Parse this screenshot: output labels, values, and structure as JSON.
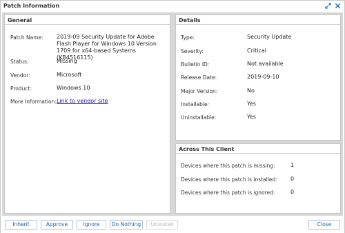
{
  "window": {
    "title": "Patch Information",
    "icons": [
      "expand-icon",
      "close-icon"
    ]
  },
  "general": {
    "header": "General",
    "rows": [
      {
        "label": "Patch Name:",
        "value": "2019-09 Security Update for Adobe Flash Player for Windows 10 Version 1709 for x64-based Systems (KB4516115)"
      },
      {
        "label": "Status:",
        "value": "Missing"
      },
      {
        "label": "Vendor:",
        "value": "Microsoft"
      },
      {
        "label": "Product:",
        "value": "Windows 10"
      },
      {
        "label": "More Information:",
        "value": "Link to vendor site"
      }
    ]
  },
  "details": {
    "header": "Details",
    "rows": [
      {
        "label": "Type:",
        "value": "Security Update"
      },
      {
        "label": "Severity:",
        "value": "Critical"
      },
      {
        "label": "Bulletin ID:",
        "value": "Not available"
      },
      {
        "label": "Release Date:",
        "value": "2019-09-10"
      },
      {
        "label": "Major Version:",
        "value": "No"
      },
      {
        "label": "Installable:",
        "value": "Yes"
      },
      {
        "label": "Uninstallable:",
        "value": "Yes"
      }
    ]
  },
  "client": {
    "header": "Across This Client",
    "rows": [
      {
        "label": "Devices where this patch is missing:",
        "value": "1"
      },
      {
        "label": "Devices where this patch is installed:",
        "value": "0"
      },
      {
        "label": "Devices where this patch is ignored:",
        "value": "0"
      }
    ]
  },
  "footer": {
    "inherit": "Inherit",
    "approve": "Approve",
    "ignore": "Ignore",
    "do_nothing": "Do Nothing",
    "uninstall": "Uninstall",
    "close": "Close"
  },
  "colors": {
    "accent": "#1e73be",
    "link": "#1a0dab",
    "button_text": "#1e5fa8",
    "disabled_text": "#b5b5b5"
  }
}
